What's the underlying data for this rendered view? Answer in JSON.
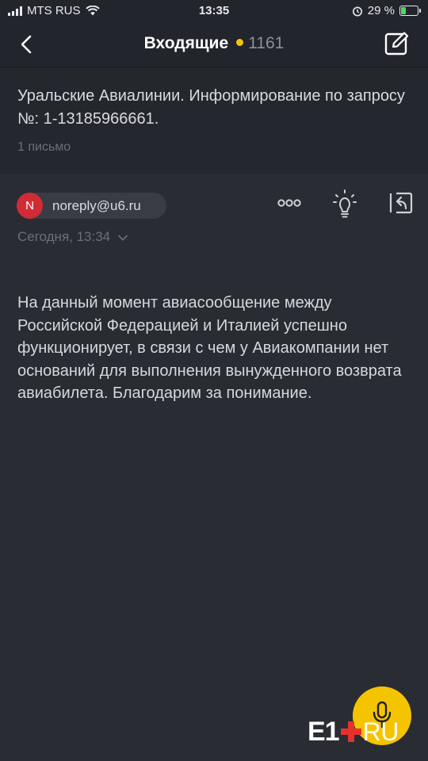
{
  "status_bar": {
    "carrier": "MTS RUS",
    "time": "13:35",
    "battery_percent_text": "29 %",
    "battery_level": 0.29,
    "icons": [
      "signal-icon",
      "wifi-icon",
      "alarm-icon",
      "battery-icon"
    ]
  },
  "nav": {
    "title": "Входящие",
    "unread_count": "1161",
    "unread_dot_color": "#f5c400",
    "icons": [
      "back-chevron-icon",
      "compose-icon"
    ]
  },
  "thread": {
    "subject": "Уральские Авиалинии. Информирование по запросу №: 1-13185966661.",
    "letters_count": "1 письмо"
  },
  "message": {
    "avatar_letter": "N",
    "avatar_color": "#d12b36",
    "sender": "noreply@u6.ru",
    "date": "Сегодня, 13:34",
    "body": "На данный момент авиасообщение между Российской Федерацией и Италией успешно функционирует, в связи с чем у Авиакомпании нет оснований для выполнения вынужденного возврата авиабилета. Благодарим за понимание.",
    "actions": [
      "more-icon",
      "lightbulb-icon",
      "reply-icon"
    ]
  },
  "fab": {
    "icon": "microphone-icon",
    "color": "#f5c400"
  },
  "watermark": {
    "part1": "E1",
    "part2": "RU"
  }
}
